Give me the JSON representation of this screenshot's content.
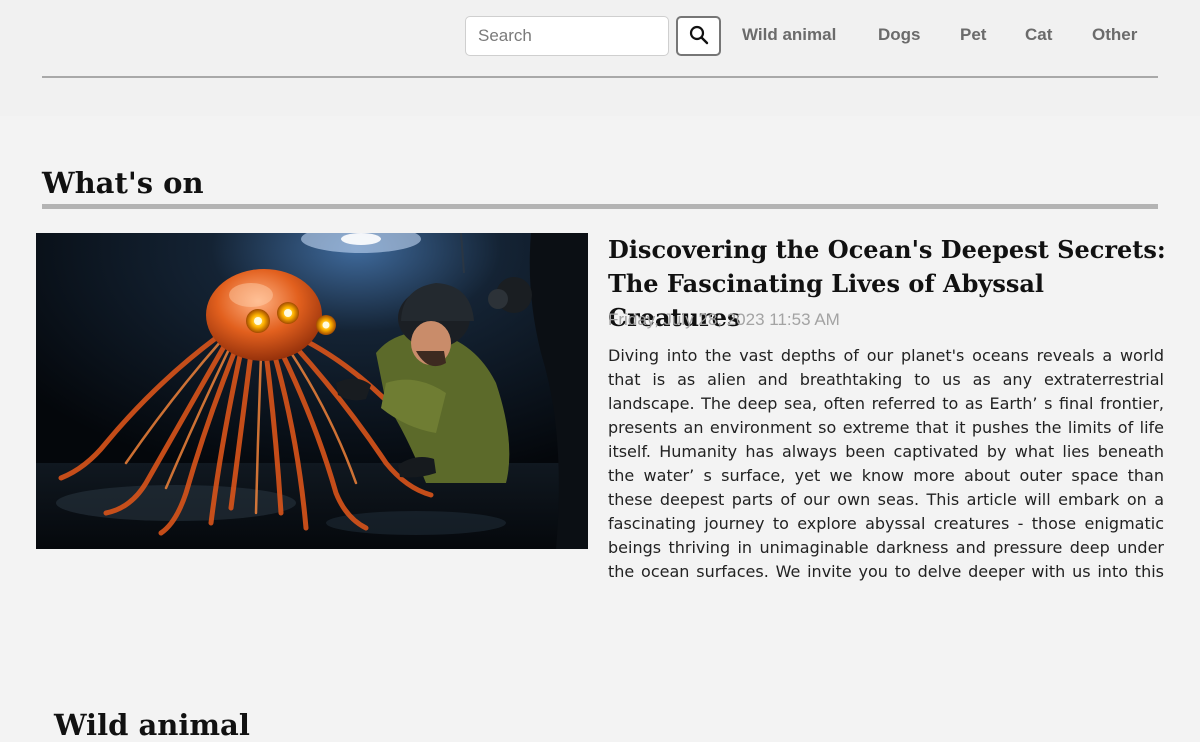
{
  "search": {
    "placeholder": "Search",
    "value": ""
  },
  "nav": {
    "items": [
      {
        "label": "Wild animal"
      },
      {
        "label": "Dogs"
      },
      {
        "label": "Pet"
      },
      {
        "label": "Cat"
      },
      {
        "label": "Other"
      }
    ]
  },
  "sections": {
    "whats_on": {
      "title": "What's on",
      "article": {
        "title": "Discovering the Ocean's Deepest Secrets: The Fascinating Lives of Abyssal Creatures",
        "date": "Friday, July 28, 2023 11:53 AM",
        "excerpt": "Diving into the vast depths of our planet's oceans reveals a world that is as alien and breathtaking to us as any extraterrestrial landscape. The deep sea, often referred to as Earth’ s final frontier, presents an environment so extreme that it pushes the limits of life itself. Humanity has always been captivated by what lies beneath the water’ s surface, yet we know more about outer space than these deepest parts of our own seas. This article will embark on a fascinating journey to explore abyssal creatures - those enigmatic beings thriving in unimaginable darkness and pressure deep under the ocean surfaces. We invite you to delve deeper with us into this mysterious world, shedding light ..."
      }
    },
    "wild_animal": {
      "title": "Wild animal"
    }
  },
  "colors": {
    "background": "#f3f3f3",
    "nav_text": "#6b6b6b",
    "date_text": "#a3a3a3",
    "divider": "#b3b3b3"
  }
}
